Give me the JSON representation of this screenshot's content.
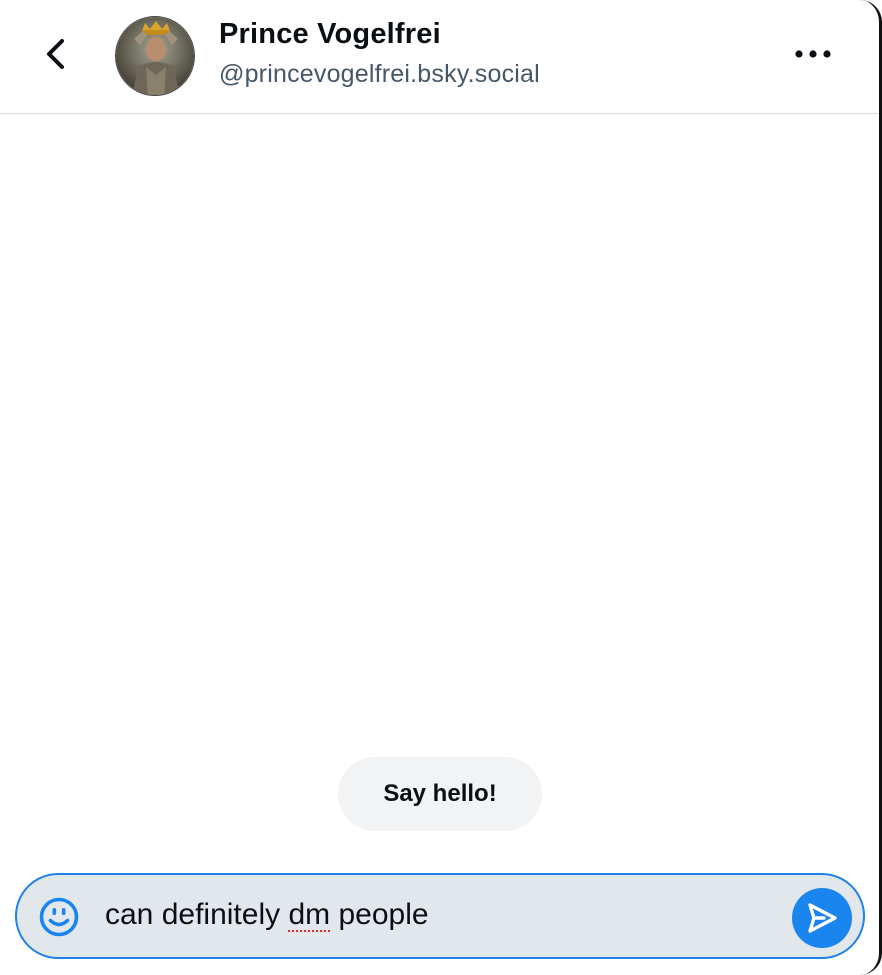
{
  "header": {
    "display_name": "Prince Vogelfrei",
    "handle": "@princevogelfrei.bsky.social",
    "back_icon": "chevron-left-icon",
    "more_icon": "ellipsis-horizontal-icon",
    "avatar_icon": "profile-avatar"
  },
  "conversation": {
    "empty_prompt_label": "Say hello!"
  },
  "composer": {
    "message_parts": [
      "can definitely ",
      "dm",
      " people"
    ],
    "emoji_icon": "smiley-face-icon",
    "send_icon": "paper-plane-icon"
  },
  "colors": {
    "accent": "#1a85ee",
    "composer_border": "#1f83e8",
    "composer_bg": "#e2e7ec",
    "handle_text": "#44576b",
    "pill_bg": "#f1f3f5",
    "spellcheck_underline": "#e0262b"
  }
}
